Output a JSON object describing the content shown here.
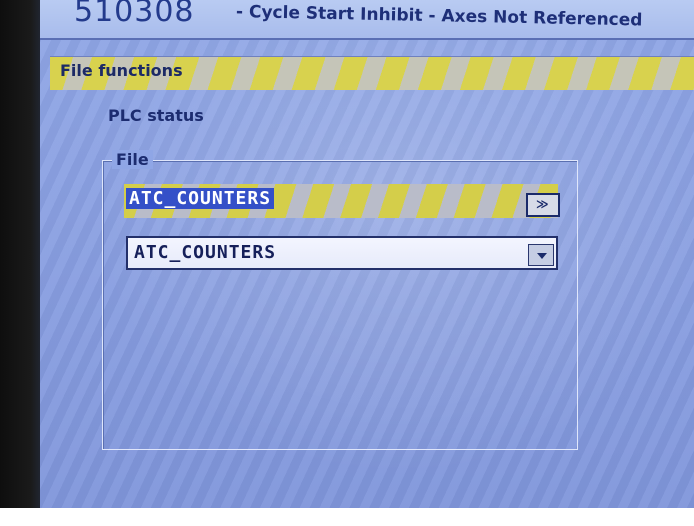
{
  "alarm": {
    "code": "510308",
    "message": "- Cycle Start Inhibit - Axes Not Referenced"
  },
  "panel": {
    "title": "File functions",
    "plc_status_label": "PLC status"
  },
  "file_group": {
    "legend": "File",
    "input_value": "ATC_COUNTERS",
    "combo_value": "ATC_COUNTERS",
    "browse_icon": "browse-icon"
  },
  "colors": {
    "screen_background": "#8aa0e2",
    "title_bar_highlight": "#d8d24e",
    "selection": "#3450c8"
  }
}
